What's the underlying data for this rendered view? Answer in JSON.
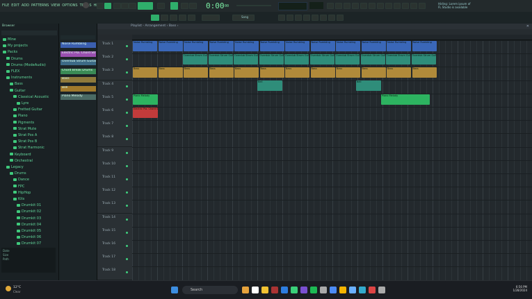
{
  "menu": [
    "FILE",
    "EDIT",
    "ADD",
    "PATTERNS",
    "VIEW",
    "OPTIONS",
    "TOOLS",
    "HELP"
  ],
  "transport": {
    "time": "0:00",
    "time_sub": ":00",
    "pat_label": "Song"
  },
  "hint": {
    "line1": "Hiding: Lorem ipsum of",
    "line2": "FL Studio is available"
  },
  "browser": {
    "title": "Browser",
    "items": [
      {
        "label": "Mine",
        "depth": 0
      },
      {
        "label": "My projects",
        "depth": 0
      },
      {
        "label": "Packs",
        "depth": 0
      },
      {
        "label": "Drums",
        "depth": 1
      },
      {
        "label": "Drums (ModeAudio)",
        "depth": 1
      },
      {
        "label": "FLEX",
        "depth": 1
      },
      {
        "label": "Instruments",
        "depth": 1
      },
      {
        "label": "Bass",
        "depth": 2
      },
      {
        "label": "Guitar",
        "depth": 2
      },
      {
        "label": "Classical Acoustic",
        "depth": 3
      },
      {
        "label": "Lyre",
        "depth": 4
      },
      {
        "label": "Fretted Guitar",
        "depth": 3
      },
      {
        "label": "Piano",
        "depth": 3
      },
      {
        "label": "Pigments",
        "depth": 3
      },
      {
        "label": "Strat Mute",
        "depth": 3
      },
      {
        "label": "Strat Pos A",
        "depth": 3
      },
      {
        "label": "Strat Pos B",
        "depth": 3
      },
      {
        "label": "Strat Harmonic",
        "depth": 3
      },
      {
        "label": "Keyboard",
        "depth": 2
      },
      {
        "label": "Orchestral",
        "depth": 2
      },
      {
        "label": "Legacy",
        "depth": 1
      },
      {
        "label": "Drums",
        "depth": 2
      },
      {
        "label": "Dance",
        "depth": 3
      },
      {
        "label": "FPC",
        "depth": 3
      },
      {
        "label": "HipHop",
        "depth": 3
      },
      {
        "label": "Kits",
        "depth": 3
      },
      {
        "label": "Drumkit 01",
        "depth": 4
      },
      {
        "label": "Drumkit 02",
        "depth": 4
      },
      {
        "label": "Drumkit 03",
        "depth": 4
      },
      {
        "label": "Drumkit 04",
        "depth": 4
      },
      {
        "label": "Drumkit 05",
        "depth": 4
      },
      {
        "label": "Drumkit 06",
        "depth": 4
      },
      {
        "label": "Drumkit 07",
        "depth": 4
      }
    ],
    "info": [
      "Date",
      "Size",
      "Path"
    ]
  },
  "channels": [
    {
      "label": "Noise Rumbling",
      "color": "#3b5fb0"
    },
    {
      "label": "Electric Pia. Chord Strum",
      "color": "#9a4fb0"
    },
    {
      "label": "Overdub Strum Guitar",
      "color": "#3c6a86"
    },
    {
      "label": "Chord Break Drums",
      "color": "#3a8a55"
    },
    {
      "label": "Bass",
      "color": "#8f7a3b"
    },
    {
      "label": "Bell",
      "color": "#a07a2c"
    },
    {
      "label": "Piano Melody",
      "color": "#4a6a64"
    }
  ],
  "playlist": {
    "title": "Playlist - Arrangement › Bass ›"
  },
  "tracks": [
    "Track 1",
    "Track 2",
    "Track 3",
    "Track 4",
    "Track 5",
    "Track 6",
    "Track 7",
    "Track 8",
    "Track 9",
    "Track 10",
    "Track 11",
    "Track 12",
    "Track 13",
    "Track 14",
    "Track 15",
    "Track 16",
    "Track 17",
    "Track 18"
  ],
  "taskbar": {
    "weather": "12°C",
    "weather_sub": "Clear",
    "search": "Search",
    "time": "6:56 PM",
    "date": "1/28/2024"
  },
  "colors": {
    "accent": "#2fd07a",
    "clip_blue": "#3a67b8",
    "clip_teal": "#2f8d7a",
    "clip_gold": "#b08a3a",
    "clip_green": "#2db360",
    "clip_red": "#c23b3b"
  }
}
